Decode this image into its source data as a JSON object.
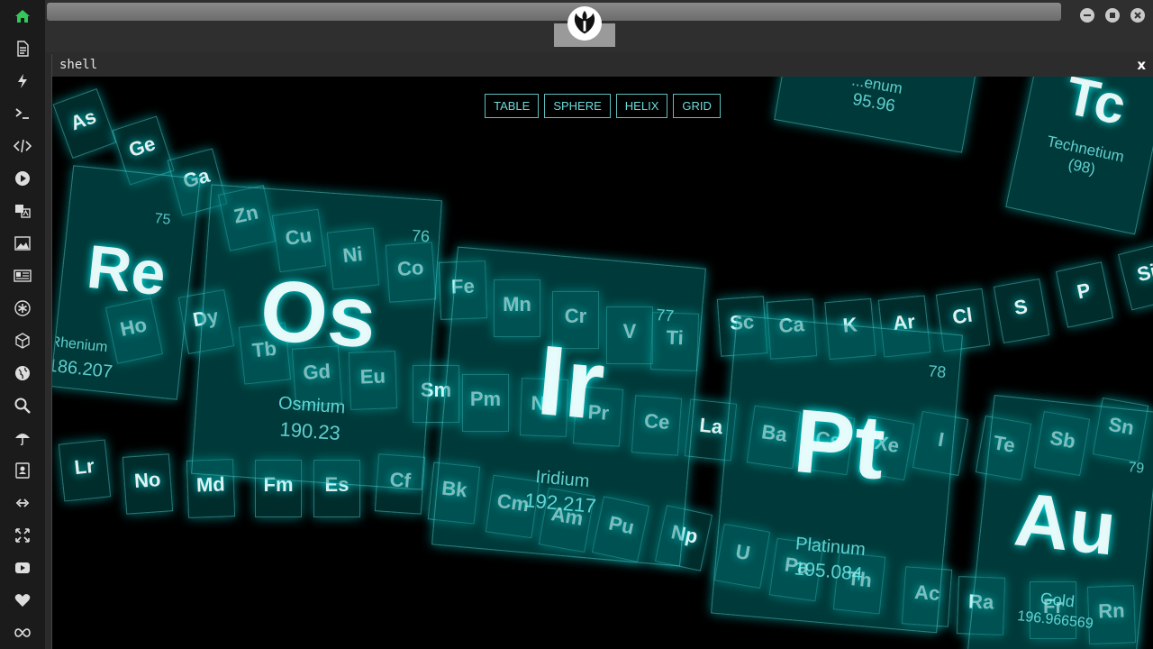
{
  "window": {
    "title": "shell",
    "close_label": "x"
  },
  "menu": {
    "table": "TABLE",
    "sphere": "SPHERE",
    "helix": "HELIX",
    "grid": "GRID"
  },
  "sidebar_icons": [
    "home-icon",
    "document-icon",
    "bolt-icon",
    "terminal-icon",
    "code-icon",
    "play-icon",
    "translate-icon",
    "image-icon",
    "news-icon",
    "asterisk-icon",
    "cube-icon",
    "globe-icon",
    "search-icon",
    "umbrella-icon",
    "contacts-icon",
    "link-icon",
    "expand-icon",
    "youtube-icon",
    "heart-icon",
    "infinity-icon"
  ],
  "colors": {
    "accent": "#34c759",
    "glow": "#7fffff",
    "tile": "#007f7f"
  },
  "elements": [
    {
      "key": "re",
      "number": "75",
      "symbol": "Re",
      "name": "Rhenium",
      "mass": "186.207"
    },
    {
      "key": "os",
      "number": "76",
      "symbol": "Os",
      "name": "Osmium",
      "mass": "190.23"
    },
    {
      "key": "ir",
      "number": "77",
      "symbol": "Ir",
      "name": "Iridium",
      "mass": "192.217"
    },
    {
      "key": "pt",
      "number": "78",
      "symbol": "Pt",
      "name": "Platinum",
      "mass": "195.084"
    },
    {
      "key": "au",
      "number": "79",
      "symbol": "Au",
      "name": "Gold",
      "mass": "196.966569"
    },
    {
      "key": "tc",
      "number": "",
      "symbol": "Tc",
      "name": "Technetium",
      "mass": "(98)"
    },
    {
      "key": "mo",
      "number": "",
      "symbol": "",
      "name": "...enum",
      "mass": "95.96"
    }
  ],
  "small_symbols": [
    "As",
    "Ge",
    "Ga",
    "Zn",
    "Cu",
    "Ni",
    "Co",
    "Fe",
    "Mn",
    "Cr",
    "V",
    "Ti",
    "Sc",
    "Ca",
    "K",
    "Ar",
    "Cl",
    "S",
    "P",
    "Si",
    "Ho",
    "Dy",
    "Tb",
    "Gd",
    "Eu",
    "Sm",
    "Pm",
    "Nd",
    "Pr",
    "Ce",
    "La",
    "Ba",
    "Cs",
    "Xe",
    "I",
    "Te",
    "Sb",
    "Sn",
    "Lr",
    "No",
    "Md",
    "Fm",
    "Es",
    "Cf",
    "Bk",
    "Cm",
    "Am",
    "Pu",
    "Np",
    "U",
    "Pa",
    "Th",
    "Ac",
    "Ra",
    "Fr",
    "Rn"
  ]
}
